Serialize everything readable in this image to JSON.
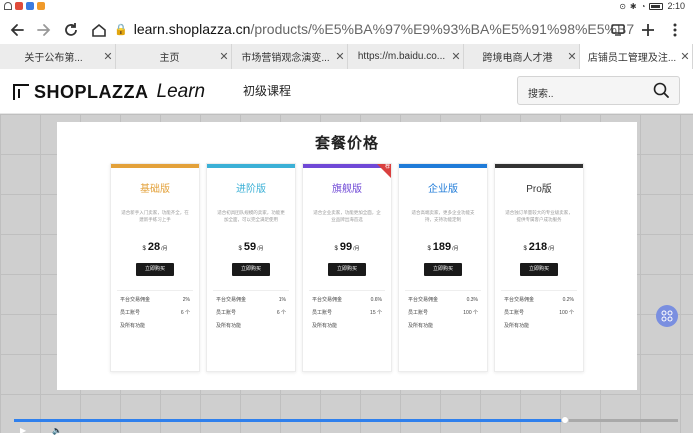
{
  "status": {
    "time": "2:10"
  },
  "browser": {
    "url_host": "learn.shoplazza.cn",
    "url_path": "/products/%E5%BA%97%E9%93%BA%E5%91%98%E5%B7%A5%E7%AE%A1"
  },
  "tabs": [
    {
      "label": "关于公布第..."
    },
    {
      "label": "主页"
    },
    {
      "label": "市场营销观念演变..."
    },
    {
      "label": "https://m.baidu.co..."
    },
    {
      "label": "跨境电商人才港"
    },
    {
      "label": "店铺员工管理及注..."
    }
  ],
  "site": {
    "logo_text": "SHOPLAZZA",
    "logo_learn": "Learn",
    "nav_course": "初级课程",
    "search_placeholder": "搜索.."
  },
  "slide": {
    "title": "套餐价格",
    "plans": [
      {
        "name": "基础版",
        "color": "#e3a13a",
        "desc": "适合新手入门卖家，功能齐全，在建新手练习上手",
        "currency": "$",
        "price": "28",
        "per": "/月",
        "buy": "立即购买",
        "features": [
          {
            "k": "平台交易佣金",
            "v": "2%"
          },
          {
            "k": "员工账号",
            "v": "6 个"
          },
          {
            "k": "及所有功能",
            "v": ""
          }
        ]
      },
      {
        "name": "进阶版",
        "color": "#3bb0d6",
        "desc": "适合初具团队规模的卖家，功能更加全面，可以完全满足使用",
        "currency": "$",
        "price": "59",
        "per": "/月",
        "buy": "立即购买",
        "features": [
          {
            "k": "平台交易佣金",
            "v": "1%"
          },
          {
            "k": "员工账号",
            "v": "6 个"
          },
          {
            "k": "及所有功能",
            "v": ""
          }
        ]
      },
      {
        "name": "旗舰版",
        "color": "#6f48d6",
        "desc": "适合企业卖家，功能更加全面，企业品牌出海首选",
        "currency": "$",
        "price": "99",
        "per": "/月",
        "buy": "立即购买",
        "ribbon": "荐",
        "features": [
          {
            "k": "平台交易佣金",
            "v": "0.6%"
          },
          {
            "k": "员工账号",
            "v": "15 个"
          },
          {
            "k": "及所有功能",
            "v": ""
          }
        ]
      },
      {
        "name": "企业版",
        "color": "#1f7bd8",
        "desc": "适合高端卖家，更多企业功能支持，支持功能定制",
        "currency": "$",
        "price": "189",
        "per": "/月",
        "buy": "立即购买",
        "features": [
          {
            "k": "平台交易佣金",
            "v": "0.3%"
          },
          {
            "k": "员工账号",
            "v": "100 个"
          },
          {
            "k": "及所有功能",
            "v": ""
          }
        ]
      },
      {
        "name": "Pro版",
        "color": "#333333",
        "desc": "适合独订单量较大的专业级卖家，提供专属客户成功服务",
        "currency": "$",
        "price": "218",
        "per": "/月",
        "buy": "立即购买",
        "features": [
          {
            "k": "平台交易佣金",
            "v": "0.2%"
          },
          {
            "k": "员工账号",
            "v": "100 个"
          },
          {
            "k": "及所有功能",
            "v": ""
          }
        ]
      }
    ]
  },
  "video": {
    "progress": 0.83
  }
}
